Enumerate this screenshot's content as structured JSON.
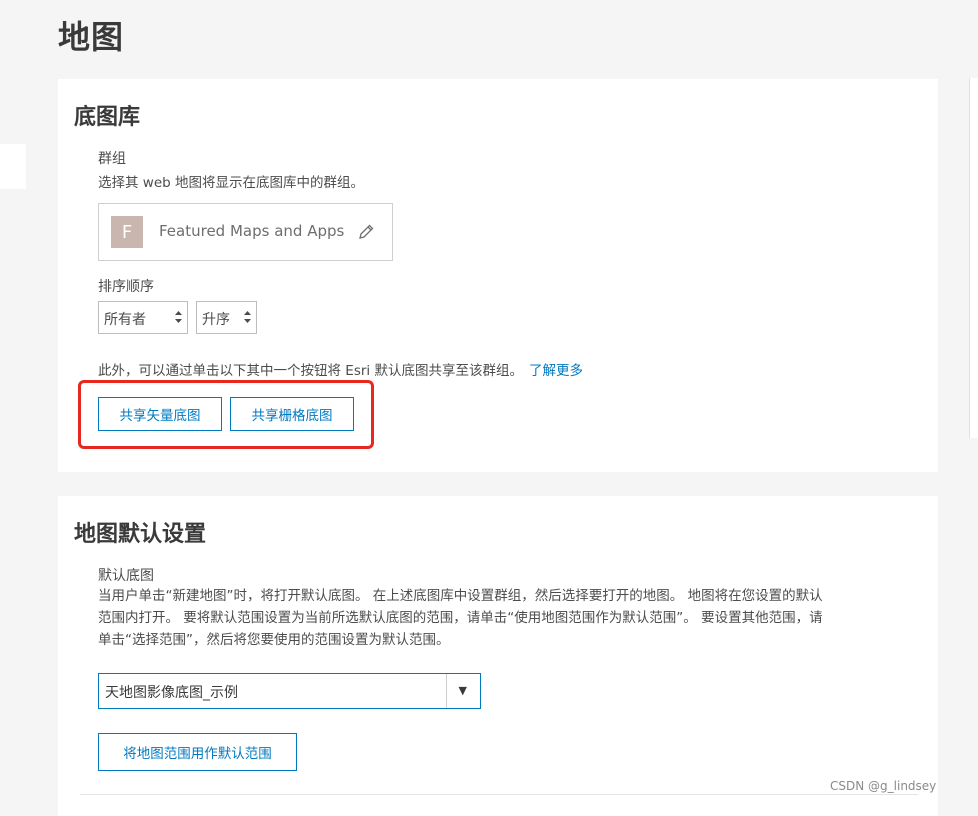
{
  "page": {
    "title": "地图"
  },
  "basemap_gallery": {
    "title": "底图库",
    "group_label": "群组",
    "group_desc": "选择其 web 地图将显示在底图库中的群组。",
    "group": {
      "avatar_letter": "F",
      "name": "Featured Maps and Apps",
      "edit_icon": "pencil-icon"
    },
    "sort_label": "排序顺序",
    "sort_field": {
      "value": "所有者"
    },
    "sort_order": {
      "value": "升序"
    },
    "share_text": "此外，可以通过单击以下其中一个按钮将 Esri 默认底图共享至该群组。",
    "learn_more": "了解更多",
    "share_vector_button": "共享矢量底图",
    "share_raster_button": "共享栅格底图",
    "highlight_color": "#e8281e"
  },
  "map_defaults": {
    "title": "地图默认设置",
    "default_basemap_label": "默认底图",
    "desc_line1": "当用户单击“新建地图”时，将打开默认底图。 在上述底图库中设置群组，然后选择要打开的地图。 地图将在您设置的默认",
    "desc_line2": "范围内打开。 要将默认范围设置为当前所选默认底图的范围，请单击“使用地图范围作为默认范围”。 要设置其他范围，请",
    "desc_line3": "单击“选择范围”，然后将您要使用的范围设置为默认范围。",
    "basemap_select": {
      "value": "天地图影像底图_示例"
    },
    "use_extent_button": "将地图范围用作默认范围"
  },
  "watermark": "CSDN @g_lindsey",
  "colors": {
    "accent": "#0079c1",
    "background": "#f5f5f5"
  }
}
